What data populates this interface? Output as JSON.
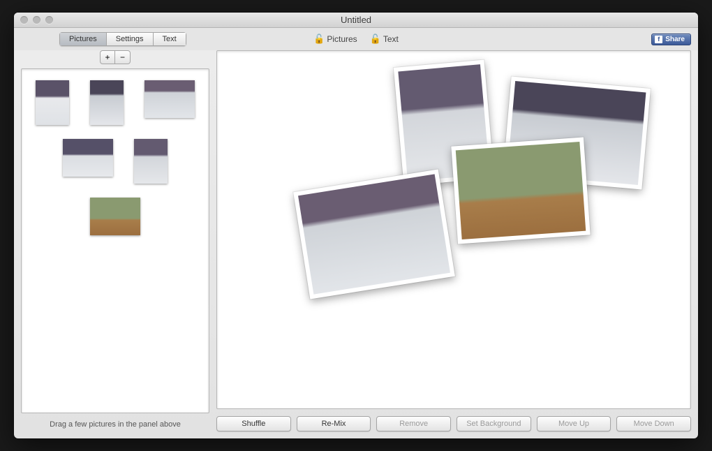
{
  "window": {
    "title": "Untitled"
  },
  "tabs": {
    "pictures": "Pictures",
    "settings": "Settings",
    "text": "Text",
    "active": "pictures"
  },
  "buttons": {
    "add": "+",
    "remove_thumb": "−",
    "share": "Share"
  },
  "locks": {
    "pictures": "Pictures",
    "text": "Text"
  },
  "sidebar": {
    "helper": "Drag a few pictures in the panel above",
    "thumbnails": [
      {
        "class": "portrait snow1"
      },
      {
        "class": "portrait snow2"
      },
      {
        "class": "landscape snow3"
      },
      {
        "class": "landscape snow4"
      },
      {
        "class": "portrait snow5"
      },
      {
        "class": "landscape path1"
      }
    ]
  },
  "canvas_photos": [
    {
      "style": "left:260px; top:18px;  width:130px; height:170px; transform:rotate(-5deg);",
      "img": "snow5"
    },
    {
      "style": "left:415px; top:45px;  width:200px; height:145px; transform:rotate(5deg);",
      "img": "snow2"
    },
    {
      "style": "left:340px; top:130px; width:190px; height:140px; transform:rotate(-4deg);",
      "img": "path1"
    },
    {
      "style": "left:120px; top:185px; width:210px; height:155px; transform:rotate(-9deg);",
      "img": "snow3"
    }
  ],
  "actions": {
    "shuffle": "Shuffle",
    "remix": "Re-Mix",
    "remove": "Remove",
    "set_background": "Set Background",
    "move_up": "Move Up",
    "move_down": "Move Down"
  }
}
